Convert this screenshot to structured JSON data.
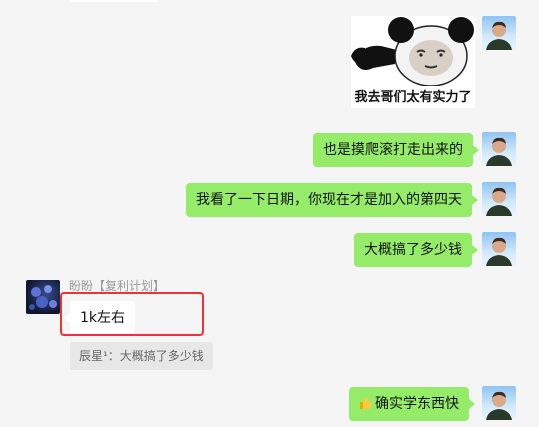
{
  "colors": {
    "background": "#f5f5f5",
    "my_bubble": "#95ec69",
    "friend_bubble": "#ffffff",
    "highlight_box": "#ee3333",
    "quote_bg": "#e7e7e7"
  },
  "messages": {
    "sticker": {
      "caption": "我去哥们太有实力了"
    },
    "m1": {
      "text": "也是摸爬滚打走出来的"
    },
    "m2": {
      "text": "我看了一下日期，你现在才是加入的第四天"
    },
    "m3": {
      "text": "大概搞了多少钱"
    },
    "friend": {
      "sender": "盼盼【复利计划】",
      "text": "1k左右",
      "quote": "辰星¹：大概搞了多少钱"
    },
    "m4": {
      "emoji": "thumbs-up-emoji",
      "text": "确实学东西快"
    }
  }
}
